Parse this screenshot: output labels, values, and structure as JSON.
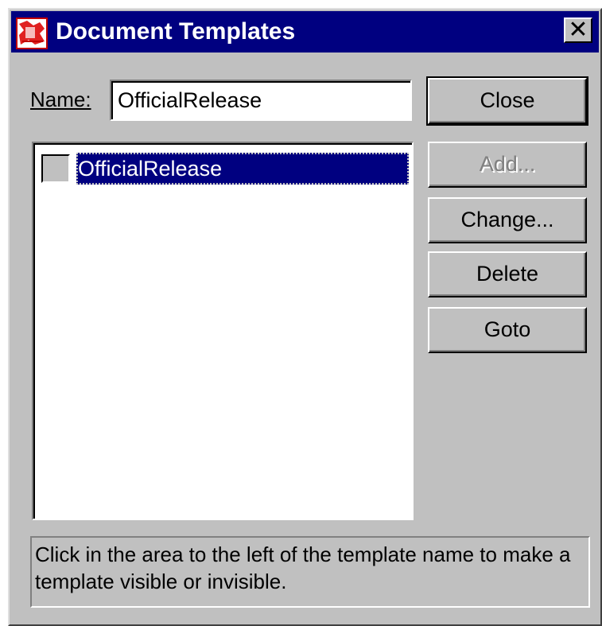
{
  "window": {
    "title": "Document Templates",
    "close_glyph": "✕",
    "icon": "document-templates-app-icon"
  },
  "form": {
    "name_label": "Name:",
    "name_value": "OfficialRelease"
  },
  "buttons": {
    "close": "Close",
    "add": "Add...",
    "change": "Change...",
    "delete": "Delete",
    "goto": "Goto"
  },
  "templates": [
    {
      "name": "OfficialRelease",
      "selected": true,
      "visible": false
    }
  ],
  "hint": "Click in the area to the left of the template name to make a template visible or invisible.",
  "colors": {
    "titlebar": "#000080",
    "dialog_face": "#c0c0c0",
    "selection": "#000080"
  }
}
